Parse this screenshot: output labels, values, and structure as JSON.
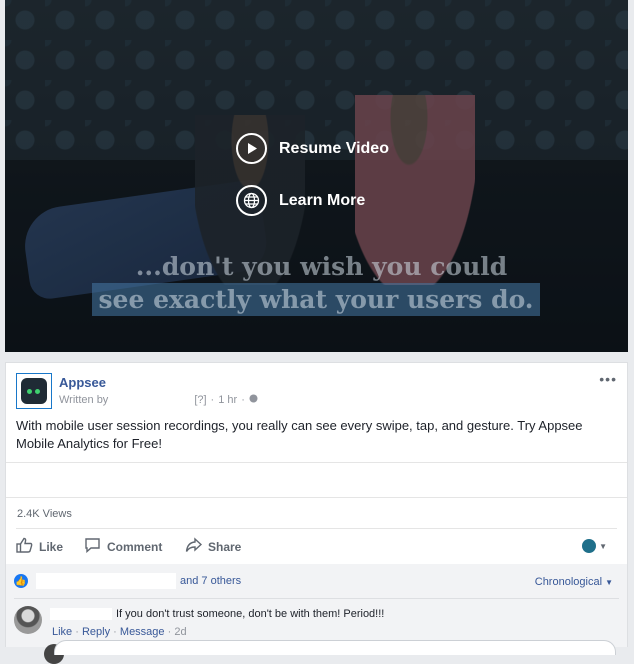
{
  "video": {
    "caption_line1": "...don't you wish you could",
    "caption_line2": "see exactly what your users do.",
    "resume_label": "Resume Video",
    "learn_more_label": "Learn More"
  },
  "post": {
    "page_name": "Appsee",
    "written_by": "Written by",
    "meta_q": "[?]",
    "time": "1 hr",
    "more": "•••",
    "text": "With mobile user session recordings, you really can see every swipe, tap, and gesture. Try Appsee Mobile Analytics for Free!",
    "views": "2.4K Views"
  },
  "actions": {
    "like": "Like",
    "comment": "Comment",
    "share": "Share"
  },
  "reactions": {
    "others": "and 7 others",
    "sort": "Chronological"
  },
  "comment": {
    "text": "If you don't trust someone, don't be with them! Period!!!",
    "like": "Like",
    "reply": "Reply",
    "message": "Message",
    "time": "2d"
  },
  "icons": [
    "play-icon",
    "globe-icon",
    "like-icon",
    "comment-icon",
    "share-icon",
    "globe-small-icon"
  ],
  "colors": {
    "link": "#385898",
    "accent": "#1877f2"
  }
}
